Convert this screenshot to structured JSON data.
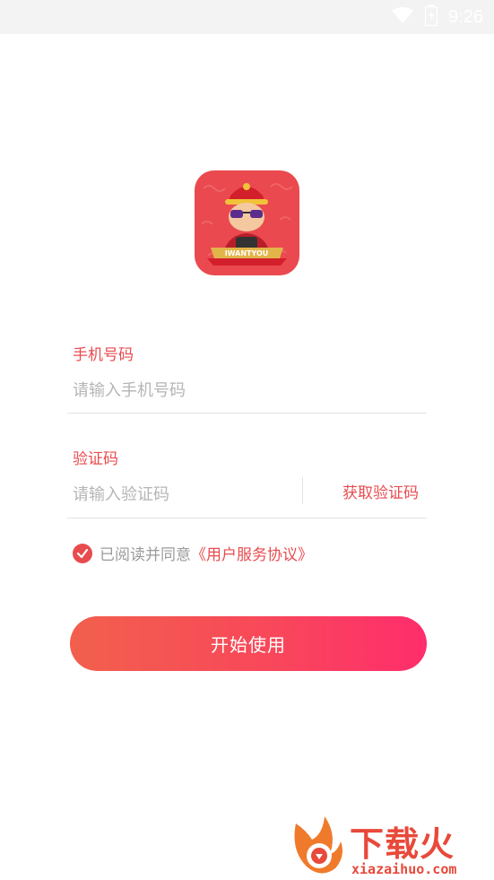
{
  "status_bar": {
    "time": "9:26",
    "icons": [
      "wifi-icon",
      "battery-icon"
    ]
  },
  "app": {
    "logo_icon": "app-logo-icon",
    "logo_text": "IWANTYOU"
  },
  "form": {
    "phone": {
      "label": "手机号码",
      "placeholder": "请输入手机号码"
    },
    "code": {
      "label": "验证码",
      "placeholder": "请输入验证码",
      "get_code_label": "获取验证码"
    },
    "agreement": {
      "checked": true,
      "text": "已阅读并同意",
      "link": "《用户服务协议》"
    },
    "submit_label": "开始使用"
  },
  "watermark": {
    "title": "下载火",
    "url": "xiazaihuo.com"
  },
  "colors": {
    "accent": "#e84b4f",
    "button_start": "#f2604d",
    "button_end": "#ff2d6c",
    "placeholder": "#b5b5b5"
  }
}
